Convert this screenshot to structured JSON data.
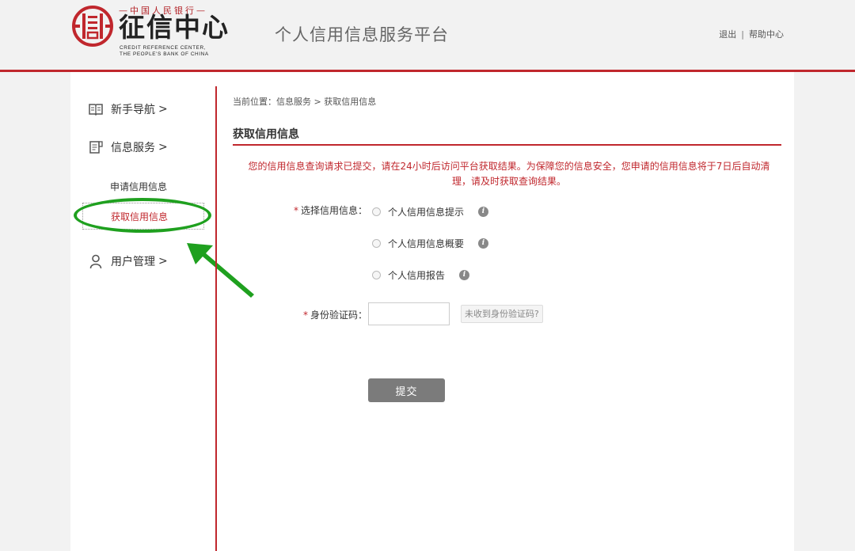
{
  "header": {
    "logo_top": "—中国人民银行—",
    "logo_main": "征信中心",
    "logo_en_line1": "CREDIT REFERENCE CENTER,",
    "logo_en_line2": "THE PEOPLE'S BANK OF CHINA",
    "site_title": "个人信用信息服务平台",
    "logout_label": "退出",
    "separator": "|",
    "help_label": "帮助中心"
  },
  "sidebar": {
    "items": [
      {
        "label": "新手导航",
        "chevron": ">",
        "icon": "book-icon"
      },
      {
        "label": "信息服务",
        "chevron": ">",
        "icon": "document-icon"
      },
      {
        "label": "用户管理",
        "chevron": ">",
        "icon": "user-icon"
      }
    ],
    "sub_items": [
      {
        "label": "申请信用信息"
      },
      {
        "label": "获取信用信息",
        "active": true
      }
    ]
  },
  "main": {
    "breadcrumb": "当前位置：信息服务 > 获取信用信息",
    "section_title": "获取信用信息",
    "notice": "您的信用信息查询请求已提交，请在24小时后访问平台获取结果。为保障您的信息安全，您申请的信用信息将于7日后自动清理，请及时获取查询结果。",
    "form": {
      "required_mark": "*",
      "select_label": "选择信用信息：",
      "options": [
        {
          "label": "个人信用信息提示"
        },
        {
          "label": "个人信用信息概要"
        },
        {
          "label": "个人信用报告"
        }
      ],
      "info_glyph": "i",
      "code_label": "身份验证码：",
      "code_value": "",
      "resend_label": "未收到身份验证码?",
      "submit_label": "提交"
    }
  },
  "colors": {
    "brand_red": "#c0272d",
    "highlight_green": "#1fa01f",
    "submit_gray": "#7b7b7b"
  }
}
